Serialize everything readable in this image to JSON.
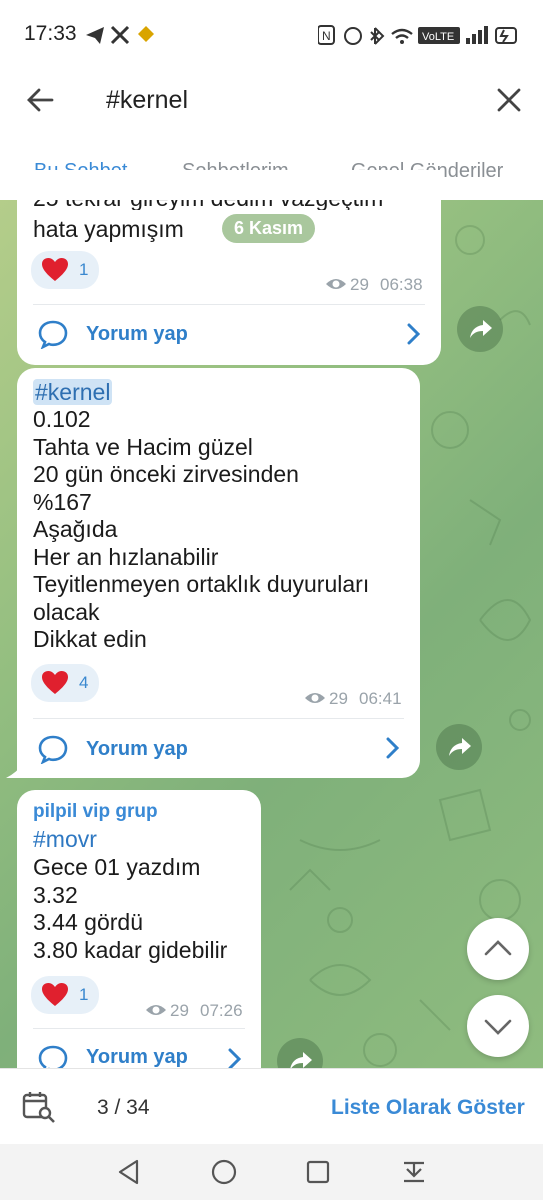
{
  "status_bar": {
    "time": "17:33",
    "network_badge": "VoLTE"
  },
  "search": {
    "query": "#kernel"
  },
  "tabs": [
    {
      "label": "Bu Sohbet",
      "active": true
    },
    {
      "label": "Sohbetlerim",
      "active": false
    },
    {
      "label": "Genel Gönderiler",
      "active": false
    }
  ],
  "messages": [
    {
      "partial_line": "25 tekrar gireyim dedim vazgeçtim",
      "text_line": "hata yapmışım",
      "date_pill": "6 Kasım",
      "reaction": {
        "icon": "heart-icon",
        "count": "1"
      },
      "views": "29",
      "time": "06:38",
      "comment_label": "Yorum yap"
    },
    {
      "hashtag": "#kernel",
      "body": "0.102\nTahta ve Hacim güzel\n20 gün önceki zirvesinden\n%167\nAşağıda\nHer an hızlanabilir\nTeyitlenmeyen ortaklık duyuruları\nolacak\nDikkat edin",
      "reaction": {
        "icon": "heart-icon",
        "count": "4"
      },
      "views": "29",
      "time": "06:41",
      "comment_label": "Yorum yap"
    },
    {
      "sender": "pilpil vip grup",
      "hashtag": "#movr",
      "body": "Gece 01 yazdım\n3.32\n3.44 gördü\n3.80 kadar gidebilir",
      "reaction": {
        "icon": "heart-icon",
        "count": "1"
      },
      "views": "29",
      "time": "07:26",
      "comment_label": "Yorum yap"
    }
  ],
  "bottom_bar": {
    "counter": "3 / 34",
    "list_view_label": "Liste Olarak Göster"
  },
  "colors": {
    "accent": "#3a8ad6",
    "heart": "#e0202e",
    "chat_bg": "#8fbc7f"
  }
}
